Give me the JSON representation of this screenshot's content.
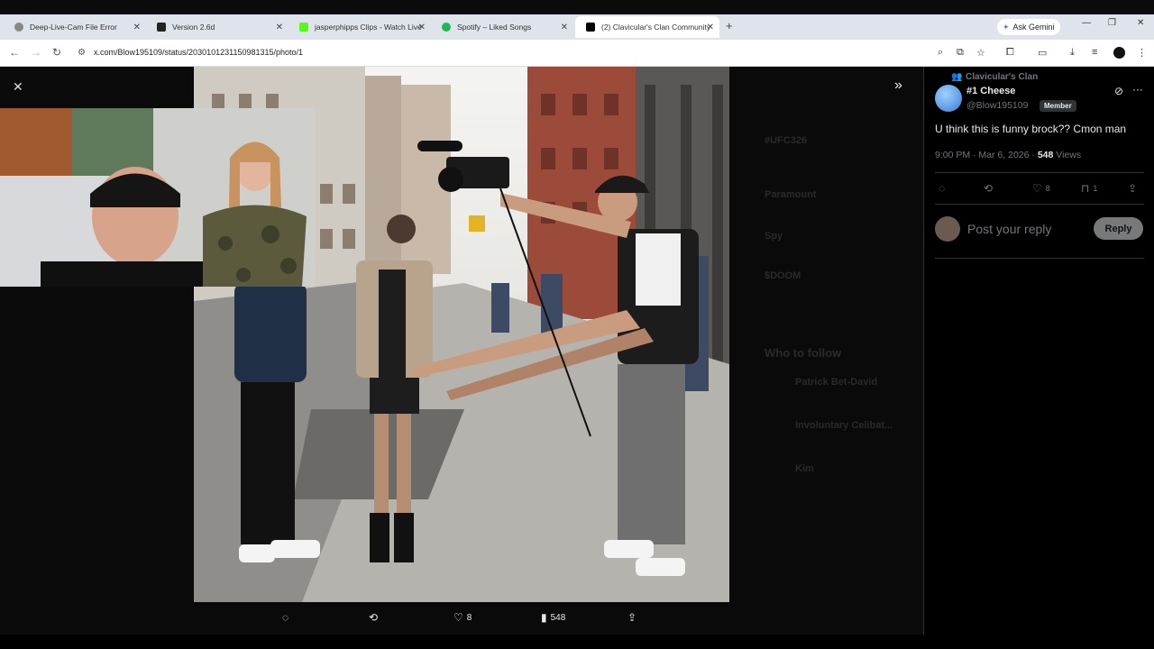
{
  "browser": {
    "tabs": [
      {
        "title": "Deep-Live-Cam File Error",
        "favicon_color": "#888888"
      },
      {
        "title": "Version 2.6d",
        "favicon_color": "#222222"
      },
      {
        "title": "jasperphipps Clips - Watch Live",
        "favicon_color": "#53fc18"
      },
      {
        "title": "Spotify – Liked Songs",
        "favicon_color": "#1db954"
      },
      {
        "title": "(2) Clavicular's Clan Community",
        "favicon_color": "#000000"
      }
    ],
    "new_tab": "+",
    "ask_gemini": "Ask Gemini",
    "url": "x.com/Blow195109/status/2030101231150981315/photo/1"
  },
  "viewer": {
    "actions": {
      "likes": "8",
      "views": "548"
    },
    "background_labels": [
      "#UFC326",
      "Paramount",
      "Spy",
      "$DOOM",
      "Who to follow",
      "Patrick Bet-David",
      "Involuntary Celibat...",
      "Kim"
    ]
  },
  "post": {
    "community": "Clavicular's Clan",
    "display_name": "#1 Cheese",
    "handle": "@Blow195109",
    "badge": "Member",
    "text": "U think this is funny brock?? Cmon man",
    "timestamp": "9:00 PM · Mar 6, 2026 · ",
    "views_count": "548",
    "views_label": "Views",
    "likes": "8",
    "bookmarks": "1",
    "reply_placeholder": "Post your reply",
    "reply_button": "Reply"
  }
}
